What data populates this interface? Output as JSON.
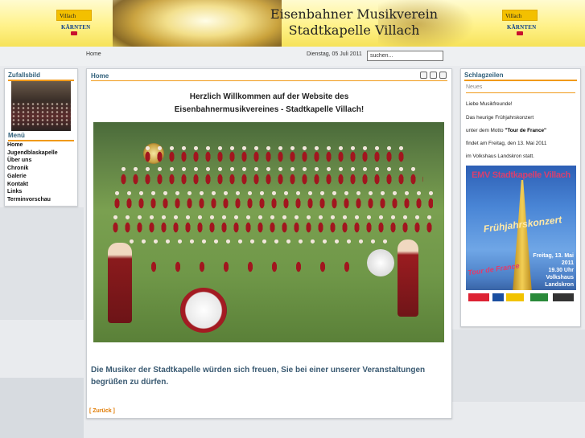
{
  "header": {
    "title_line1": "Eisenbahner Musikverein",
    "title_line2": "Stadtkapelle Villach",
    "logo_villach": "Villach",
    "logo_kaernten": "KÄRNTEN"
  },
  "topbar": {
    "breadcrumb": "Home",
    "date": "Dienstag, 05 Juli 2011",
    "search_value": "suchen..."
  },
  "left": {
    "random_image_title": "Zufallsbild",
    "menu_title": "Menü",
    "menu_items": [
      "Home",
      "Jugendblaskapelle",
      "Über uns",
      "Chronik",
      "Galerie",
      "Kontakt",
      "Links",
      "Terminvorschau"
    ]
  },
  "main": {
    "heading": "Home",
    "welcome_line1": "Herzlich Willkommen auf der Website des",
    "welcome_line2": "Eisenbahnermusikvereines - Stadtkapelle Villach!",
    "closing_text": "Die Musiker der Stadtkapelle würden sich freuen, Sie bei einer unserer Veranstaltungen begrüßen zu dürfen.",
    "back_link": "[ Zurück ]",
    "tool_icons": [
      "pdf-icon",
      "print-icon",
      "email-icon"
    ]
  },
  "right": {
    "heading": "Schlagzeilen",
    "news_heading": "Neues",
    "lines": [
      "Liebe Musikfreunde!",
      "Das heurige Frühjahrskonzert",
      "unter dem Motto",
      "\"Tour de France\"",
      "findet am Freitag, den 13. Mai 2011",
      "im Volkshaus Landskron statt."
    ],
    "poster": {
      "title": "EMV Stadtkapelle Villach",
      "subtitle": "Frühjahrskonzert",
      "date_line1": "Freitag, 13. Mai 2011",
      "date_line2": "19.30 Uhr",
      "date_line3": "Volkshaus Landskron",
      "tdf": "Tour de France"
    }
  },
  "colors": {
    "accent_orange": "#f19a1a",
    "heading_blue": "#2f5f7a",
    "header_yellow": "#fff28a"
  }
}
